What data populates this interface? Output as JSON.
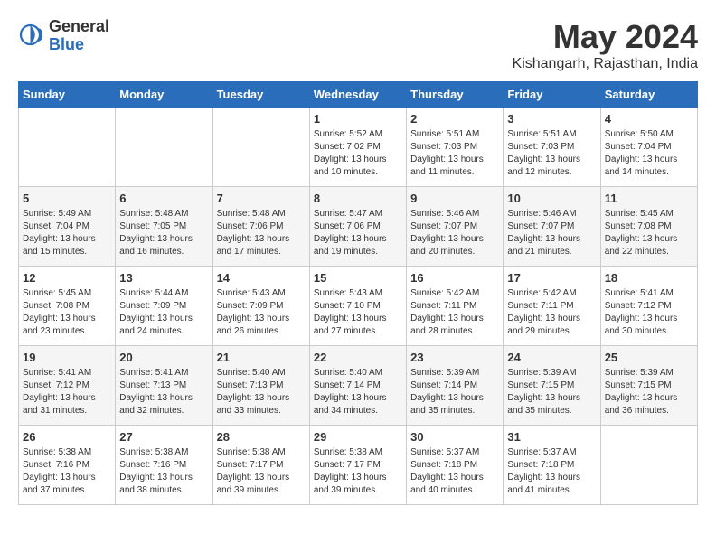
{
  "header": {
    "logo_general": "General",
    "logo_blue": "Blue",
    "month": "May 2024",
    "location": "Kishangarh, Rajasthan, India"
  },
  "days_of_week": [
    "Sunday",
    "Monday",
    "Tuesday",
    "Wednesday",
    "Thursday",
    "Friday",
    "Saturday"
  ],
  "weeks": [
    [
      {
        "day": "",
        "info": ""
      },
      {
        "day": "",
        "info": ""
      },
      {
        "day": "",
        "info": ""
      },
      {
        "day": "1",
        "info": "Sunrise: 5:52 AM\nSunset: 7:02 PM\nDaylight: 13 hours\nand 10 minutes."
      },
      {
        "day": "2",
        "info": "Sunrise: 5:51 AM\nSunset: 7:03 PM\nDaylight: 13 hours\nand 11 minutes."
      },
      {
        "day": "3",
        "info": "Sunrise: 5:51 AM\nSunset: 7:03 PM\nDaylight: 13 hours\nand 12 minutes."
      },
      {
        "day": "4",
        "info": "Sunrise: 5:50 AM\nSunset: 7:04 PM\nDaylight: 13 hours\nand 14 minutes."
      }
    ],
    [
      {
        "day": "5",
        "info": "Sunrise: 5:49 AM\nSunset: 7:04 PM\nDaylight: 13 hours\nand 15 minutes."
      },
      {
        "day": "6",
        "info": "Sunrise: 5:48 AM\nSunset: 7:05 PM\nDaylight: 13 hours\nand 16 minutes."
      },
      {
        "day": "7",
        "info": "Sunrise: 5:48 AM\nSunset: 7:06 PM\nDaylight: 13 hours\nand 17 minutes."
      },
      {
        "day": "8",
        "info": "Sunrise: 5:47 AM\nSunset: 7:06 PM\nDaylight: 13 hours\nand 19 minutes."
      },
      {
        "day": "9",
        "info": "Sunrise: 5:46 AM\nSunset: 7:07 PM\nDaylight: 13 hours\nand 20 minutes."
      },
      {
        "day": "10",
        "info": "Sunrise: 5:46 AM\nSunset: 7:07 PM\nDaylight: 13 hours\nand 21 minutes."
      },
      {
        "day": "11",
        "info": "Sunrise: 5:45 AM\nSunset: 7:08 PM\nDaylight: 13 hours\nand 22 minutes."
      }
    ],
    [
      {
        "day": "12",
        "info": "Sunrise: 5:45 AM\nSunset: 7:08 PM\nDaylight: 13 hours\nand 23 minutes."
      },
      {
        "day": "13",
        "info": "Sunrise: 5:44 AM\nSunset: 7:09 PM\nDaylight: 13 hours\nand 24 minutes."
      },
      {
        "day": "14",
        "info": "Sunrise: 5:43 AM\nSunset: 7:09 PM\nDaylight: 13 hours\nand 26 minutes."
      },
      {
        "day": "15",
        "info": "Sunrise: 5:43 AM\nSunset: 7:10 PM\nDaylight: 13 hours\nand 27 minutes."
      },
      {
        "day": "16",
        "info": "Sunrise: 5:42 AM\nSunset: 7:11 PM\nDaylight: 13 hours\nand 28 minutes."
      },
      {
        "day": "17",
        "info": "Sunrise: 5:42 AM\nSunset: 7:11 PM\nDaylight: 13 hours\nand 29 minutes."
      },
      {
        "day": "18",
        "info": "Sunrise: 5:41 AM\nSunset: 7:12 PM\nDaylight: 13 hours\nand 30 minutes."
      }
    ],
    [
      {
        "day": "19",
        "info": "Sunrise: 5:41 AM\nSunset: 7:12 PM\nDaylight: 13 hours\nand 31 minutes."
      },
      {
        "day": "20",
        "info": "Sunrise: 5:41 AM\nSunset: 7:13 PM\nDaylight: 13 hours\nand 32 minutes."
      },
      {
        "day": "21",
        "info": "Sunrise: 5:40 AM\nSunset: 7:13 PM\nDaylight: 13 hours\nand 33 minutes."
      },
      {
        "day": "22",
        "info": "Sunrise: 5:40 AM\nSunset: 7:14 PM\nDaylight: 13 hours\nand 34 minutes."
      },
      {
        "day": "23",
        "info": "Sunrise: 5:39 AM\nSunset: 7:14 PM\nDaylight: 13 hours\nand 35 minutes."
      },
      {
        "day": "24",
        "info": "Sunrise: 5:39 AM\nSunset: 7:15 PM\nDaylight: 13 hours\nand 35 minutes."
      },
      {
        "day": "25",
        "info": "Sunrise: 5:39 AM\nSunset: 7:15 PM\nDaylight: 13 hours\nand 36 minutes."
      }
    ],
    [
      {
        "day": "26",
        "info": "Sunrise: 5:38 AM\nSunset: 7:16 PM\nDaylight: 13 hours\nand 37 minutes."
      },
      {
        "day": "27",
        "info": "Sunrise: 5:38 AM\nSunset: 7:16 PM\nDaylight: 13 hours\nand 38 minutes."
      },
      {
        "day": "28",
        "info": "Sunrise: 5:38 AM\nSunset: 7:17 PM\nDaylight: 13 hours\nand 39 minutes."
      },
      {
        "day": "29",
        "info": "Sunrise: 5:38 AM\nSunset: 7:17 PM\nDaylight: 13 hours\nand 39 minutes."
      },
      {
        "day": "30",
        "info": "Sunrise: 5:37 AM\nSunset: 7:18 PM\nDaylight: 13 hours\nand 40 minutes."
      },
      {
        "day": "31",
        "info": "Sunrise: 5:37 AM\nSunset: 7:18 PM\nDaylight: 13 hours\nand 41 minutes."
      },
      {
        "day": "",
        "info": ""
      }
    ]
  ]
}
